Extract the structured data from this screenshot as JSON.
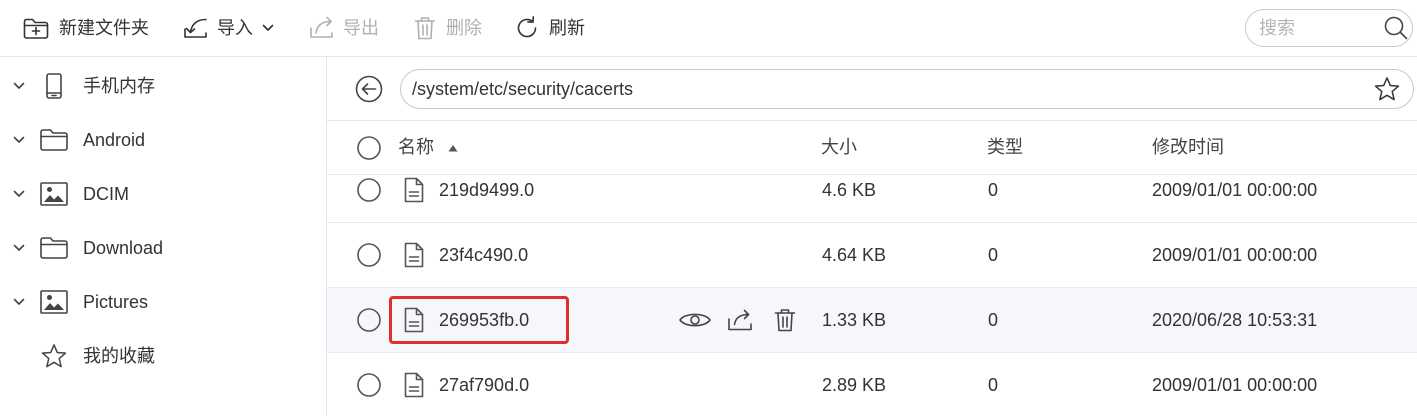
{
  "toolbar": {
    "new_folder": {
      "label": "新建文件夹",
      "icon": "folder-plus-icon",
      "disabled": false
    },
    "import": {
      "label": "导入",
      "icon": "import-icon",
      "dropdown_icon": "chevron-down-icon",
      "disabled": false
    },
    "export": {
      "label": "导出",
      "icon": "export-icon",
      "disabled": true
    },
    "delete": {
      "label": "删除",
      "icon": "trash-icon",
      "disabled": true
    },
    "refresh": {
      "label": "刷新",
      "icon": "refresh-icon",
      "disabled": false
    },
    "search": {
      "placeholder": "搜索",
      "icon": "search-icon"
    }
  },
  "sidebar": {
    "items": [
      {
        "label": "手机内存",
        "icon": "phone-icon",
        "chevron": "chevron-down-icon"
      },
      {
        "label": "Android",
        "icon": "folder-icon",
        "chevron": "chevron-down-icon"
      },
      {
        "label": "DCIM",
        "icon": "image-icon",
        "chevron": "chevron-down-icon"
      },
      {
        "label": "Download",
        "icon": "folder-icon",
        "chevron": "chevron-down-icon"
      },
      {
        "label": "Pictures",
        "icon": "image-icon",
        "chevron": "chevron-down-icon"
      },
      {
        "label": "我的收藏",
        "icon": "star-icon"
      }
    ]
  },
  "path_bar": {
    "back_icon": "back-arrow-icon",
    "path": "/system/etc/security/cacerts",
    "favorite_icon": "star-icon"
  },
  "file_table": {
    "columns": {
      "name": {
        "label": "名称",
        "sort_icon": "sort-asc-icon"
      },
      "size": {
        "label": "大小"
      },
      "type": {
        "label": "类型"
      },
      "modified": {
        "label": "修改时间"
      }
    },
    "rows": [
      {
        "name": "219d9499.0",
        "size": "4.6 KB",
        "type": "0",
        "modified": "2009/01/01 00:00:00",
        "icon": "file-icon",
        "selected": false,
        "hovered": false,
        "highlighted": false
      },
      {
        "name": "23f4c490.0",
        "size": "4.64 KB",
        "type": "0",
        "modified": "2009/01/01 00:00:00",
        "icon": "file-icon",
        "selected": false,
        "hovered": false,
        "highlighted": false
      },
      {
        "name": "269953fb.0",
        "size": "1.33 KB",
        "type": "0",
        "modified": "2020/06/28 10:53:31",
        "icon": "file-icon",
        "selected": false,
        "hovered": true,
        "highlighted": true,
        "actions": [
          "eye-icon",
          "share-icon",
          "trash-icon"
        ]
      },
      {
        "name": "27af790d.0",
        "size": "2.89 KB",
        "type": "0",
        "modified": "2009/01/01 00:00:00",
        "icon": "file-icon",
        "selected": false,
        "hovered": false,
        "highlighted": false
      }
    ]
  },
  "colors": {
    "text": "#333333",
    "disabled_text": "#b0b0b0",
    "border": "#e6e6e6",
    "hover_row_bg": "#f5f7fa",
    "highlight_box": "#e02d2d"
  }
}
